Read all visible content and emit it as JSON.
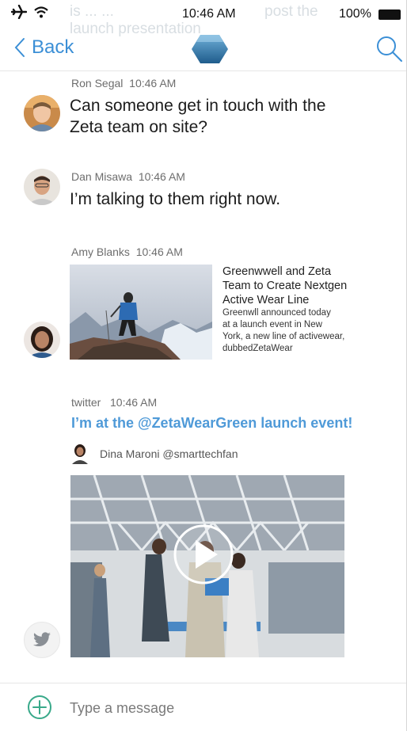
{
  "status_bar": {
    "time": "10:46 AM",
    "battery_pct": "100%"
  },
  "background_text": {
    "line1": "is ... ...",
    "line2": "launch presentation",
    "right": "post the"
  },
  "nav": {
    "back_label": "Back"
  },
  "messages": [
    {
      "sender": "Ron Segal",
      "time": "10:46 AM",
      "text_line1": "Can someone get in touch with the",
      "text_line2": "Zeta team on site?"
    },
    {
      "sender": "Dan Misawa",
      "time": "10:46 AM",
      "text": "I’m talking to them right now."
    },
    {
      "sender": "Amy Blanks",
      "time": "10:46 AM"
    }
  ],
  "link_card": {
    "title_line1": "Greenwwell and Zeta",
    "title_line2": "Team to Create Nextgen",
    "title_line3": "Active Wear Line",
    "desc_line1": "Greenwll announced today",
    "desc_line2": "at a launch event in New",
    "desc_line3": "York, a new line of activewear,",
    "desc_line4": "dubbedZetaWear"
  },
  "tweet": {
    "source": "twitter",
    "time": "10:46 AM",
    "text": "I’m at the @ZetaWearGreen launch event!",
    "author": "Dina Maroni @smarttechfan"
  },
  "composer": {
    "placeholder": "Type a message"
  },
  "colors": {
    "accent": "#3b8fd6",
    "tweet_link": "#4f9ad8",
    "logo": "#2f6f9f"
  }
}
